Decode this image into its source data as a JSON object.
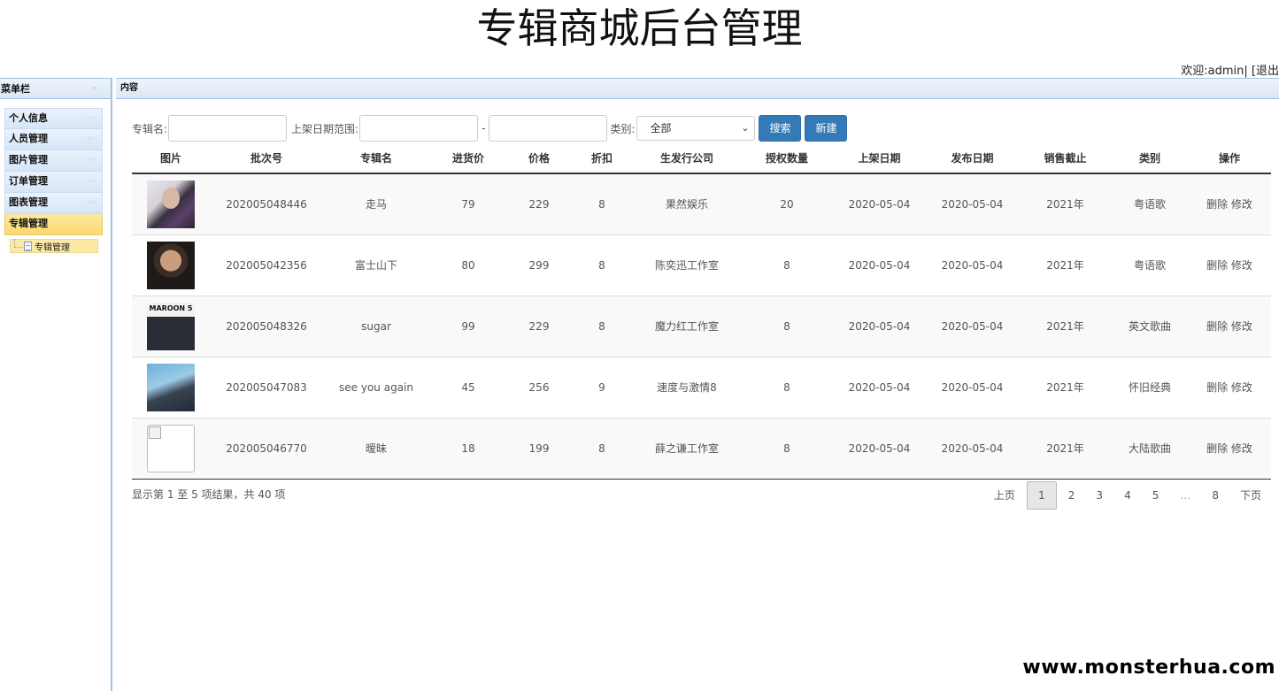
{
  "app_title": "专辑商城后台管理",
  "welcome": "欢迎:admin| [退出",
  "sidebar": {
    "title": "菜单栏",
    "items": [
      {
        "label": "个人信息"
      },
      {
        "label": "人员管理"
      },
      {
        "label": "图片管理"
      },
      {
        "label": "订单管理"
      },
      {
        "label": "图表管理"
      },
      {
        "label": "专辑管理"
      }
    ],
    "submenu": [
      {
        "label": "专辑管理"
      }
    ]
  },
  "content": {
    "title": "内容"
  },
  "search": {
    "name_label": "专辑名:",
    "date_label": "上架日期范围:",
    "date_sep": "-",
    "category_label": "类别:",
    "category_value": "全部",
    "search_button": "搜索",
    "new_button": "新建"
  },
  "table": {
    "headers": [
      "图片",
      "批次号",
      "专辑名",
      "进货价",
      "价格",
      "折扣",
      "生发行公司",
      "授权数量",
      "上架日期",
      "发布日期",
      "销售截止",
      "类别",
      "操作"
    ],
    "rows": [
      {
        "image": "album-cover",
        "batch": "202005048446",
        "name": "走马",
        "cost": "79",
        "price": "229",
        "discount": "8",
        "publisher": "果然娱乐",
        "license": "20",
        "shelf_date": "2020-05-04",
        "release_date": "2020-05-04",
        "sale_end": "2021年",
        "category": "粤语歌",
        "delete": "删除",
        "edit": "修改"
      },
      {
        "image": "album-cover",
        "batch": "202005042356",
        "name": "富士山下",
        "cost": "80",
        "price": "299",
        "discount": "8",
        "publisher": "陈奕迅工作室",
        "license": "8",
        "shelf_date": "2020-05-04",
        "release_date": "2020-05-04",
        "sale_end": "2021年",
        "category": "粤语歌",
        "delete": "删除",
        "edit": "修改"
      },
      {
        "image": "album-cover",
        "image_text": "MAROON 5",
        "batch": "202005048326",
        "name": "sugar",
        "cost": "99",
        "price": "229",
        "discount": "8",
        "publisher": "魔力红工作室",
        "license": "8",
        "shelf_date": "2020-05-04",
        "release_date": "2020-05-04",
        "sale_end": "2021年",
        "category": "英文歌曲",
        "delete": "删除",
        "edit": "修改"
      },
      {
        "image": "album-cover",
        "batch": "202005047083",
        "name": "see you again",
        "cost": "45",
        "price": "256",
        "discount": "9",
        "publisher": "速度与激情8",
        "license": "8",
        "shelf_date": "2020-05-04",
        "release_date": "2020-05-04",
        "sale_end": "2021年",
        "category": "怀旧经典",
        "delete": "删除",
        "edit": "修改"
      },
      {
        "image": "broken-image",
        "batch": "202005046770",
        "name": "暧昧",
        "cost": "18",
        "price": "199",
        "discount": "8",
        "publisher": "薛之谦工作室",
        "license": "8",
        "shelf_date": "2020-05-04",
        "release_date": "2020-05-04",
        "sale_end": "2021年",
        "category": "大陆歌曲",
        "delete": "删除",
        "edit": "修改"
      }
    ]
  },
  "pagination": {
    "info": "显示第 1 至 5 项结果，共 40 项",
    "prev": "上页",
    "pages": [
      "1",
      "2",
      "3",
      "4",
      "5",
      "…",
      "8"
    ],
    "current": "1",
    "next": "下页"
  },
  "watermark": "www.monsterhua.com"
}
